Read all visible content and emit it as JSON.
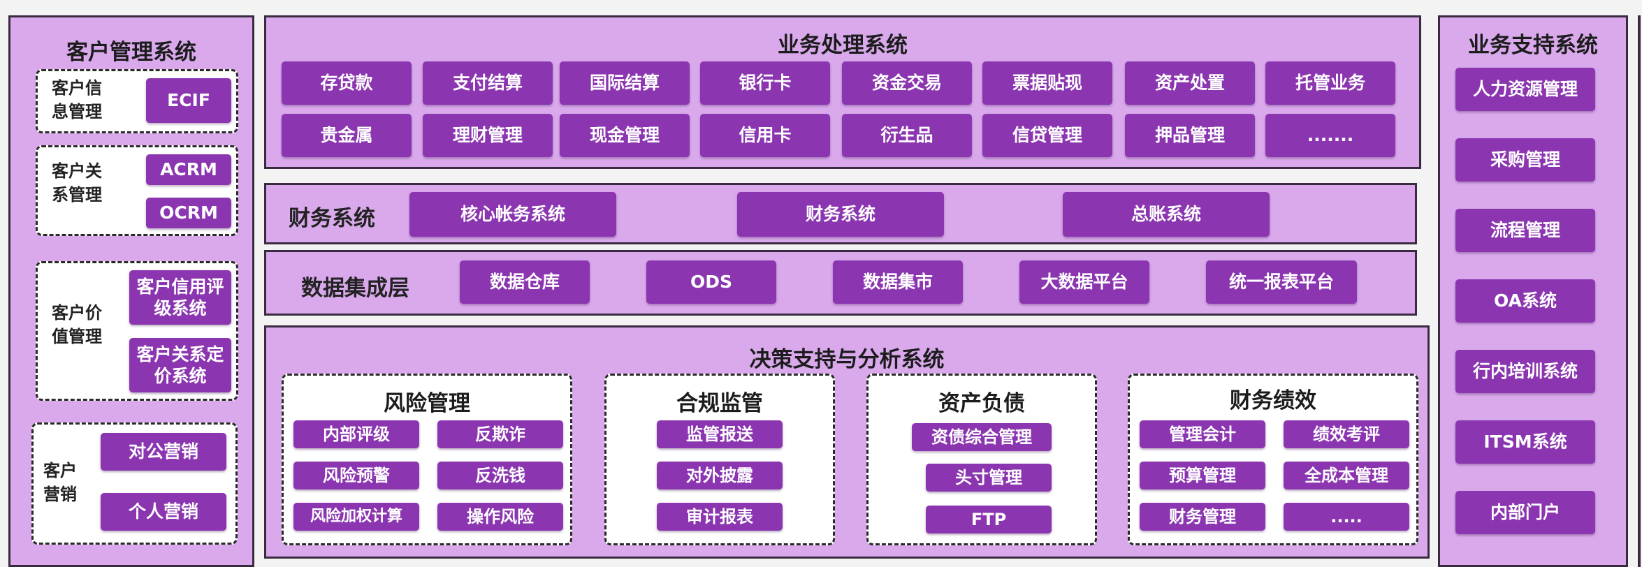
{
  "left": {
    "title": "客户管理系统",
    "info": {
      "label": "客户信息管理",
      "btn": "ECIF"
    },
    "relation": {
      "label": "客户关系管理",
      "btns": [
        "ACRM",
        "OCRM"
      ]
    },
    "value": {
      "label": "客户价值管理",
      "btns": [
        "客户信用评级系统",
        "客户关系定价系统"
      ]
    },
    "marketing": {
      "label": "客户营销",
      "btns": [
        "对公营销",
        "个人营销"
      ]
    }
  },
  "business": {
    "title": "业务处理系统",
    "row1": [
      "存贷款",
      "支付结算",
      "国际结算",
      "银行卡",
      "资金交易",
      "票据贴现",
      "资产处置",
      "托管业务"
    ],
    "row2": [
      "贵金属",
      "理财管理",
      "现金管理",
      "信用卡",
      "衍生品",
      "信贷管理",
      "押品管理",
      "......."
    ]
  },
  "finance": {
    "label": "财务系统",
    "items": [
      "核心帐务系统",
      "财务系统",
      "总账系统"
    ]
  },
  "data": {
    "label": "数据集成层",
    "items": [
      "数据仓库",
      "ODS",
      "数据集市",
      "大数据平台",
      "统一报表平台"
    ]
  },
  "decision": {
    "title": "决策支持与分析系统",
    "risk": {
      "title": "风险管理",
      "items": [
        "内部评级",
        "反欺诈",
        "风险预警",
        "反洗钱",
        "风险加权计算",
        "操作风险"
      ]
    },
    "compliance": {
      "title": "合规监管",
      "items": [
        "监管报送",
        "对外披露",
        "审计报表"
      ]
    },
    "asset": {
      "title": "资产负债",
      "items": [
        "资债综合管理",
        "头寸管理",
        "FTP"
      ]
    },
    "perf": {
      "title": "财务绩效",
      "items": [
        "管理会计",
        "绩效考评",
        "预算管理",
        "全成本管理",
        "财务管理",
        "....."
      ]
    }
  },
  "support": {
    "title": "业务支持系统",
    "items": [
      "人力资源管理",
      "采购管理",
      "流程管理",
      "OA系统",
      "行内培训系统",
      "ITSM系统",
      "内部门户"
    ]
  },
  "colors": {
    "panel": "#d9a9ec",
    "button": "#8b35b0",
    "border": "#3a2a40"
  }
}
